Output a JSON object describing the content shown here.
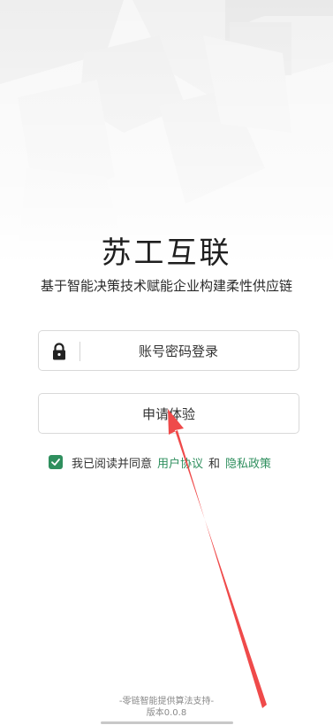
{
  "app": {
    "title": "苏工互联",
    "subtitle": "基于智能决策技术赋能企业构建柔性供应链"
  },
  "login_button": {
    "label": "账号密码登录",
    "icon": "lock-icon"
  },
  "apply_button": {
    "label": "申请体验"
  },
  "agreement": {
    "checked": true,
    "prefix": "我已阅读并同意",
    "user_agreement": "用户协议",
    "conjunction": "和",
    "privacy_policy": "隐私政策",
    "accent_color": "#2f8f5e"
  },
  "footer": {
    "provider": "-零链智能提供算法支持-",
    "version": "版本0.0.8"
  },
  "annotation": {
    "arrow_color": "#ef4a4a"
  }
}
